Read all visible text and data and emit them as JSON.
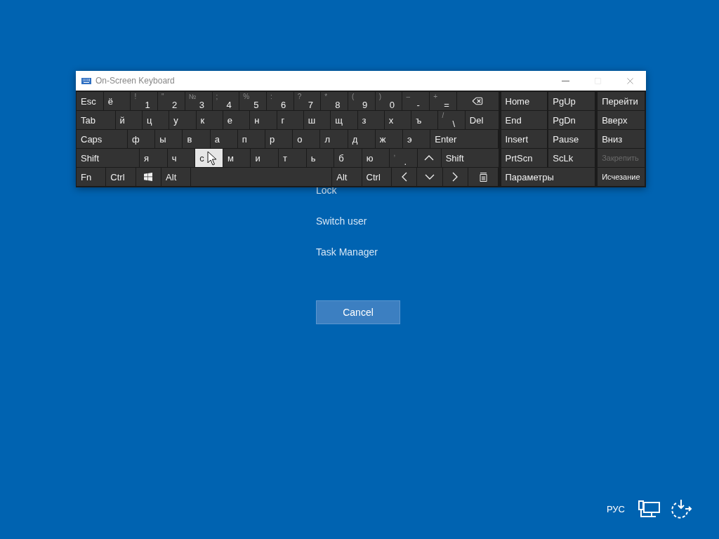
{
  "keyboard": {
    "title": "On-Screen Keyboard",
    "rows": [
      {
        "keys": [
          {
            "label": "Esc",
            "selected": false
          },
          {
            "label": "ё",
            "selected": false
          },
          {
            "label": "1",
            "shift": "!",
            "selected": false
          },
          {
            "label": "2",
            "shift": "\"",
            "selected": false
          },
          {
            "label": "3",
            "shift": "№",
            "selected": false
          },
          {
            "label": "4",
            "shift": ";",
            "selected": false
          },
          {
            "label": "5",
            "shift": "%",
            "selected": false
          },
          {
            "label": "6",
            "shift": ":",
            "selected": false
          },
          {
            "label": "7",
            "shift": "?",
            "selected": false
          },
          {
            "label": "8",
            "shift": "*",
            "selected": false
          },
          {
            "label": "9",
            "shift": "(",
            "selected": false
          },
          {
            "label": "0",
            "shift": ")",
            "selected": false
          },
          {
            "label": "-",
            "shift": "–",
            "selected": false
          },
          {
            "label": "=",
            "shift": "+",
            "selected": false
          },
          {
            "kind": "backspace",
            "selected": false
          }
        ]
      },
      {
        "keys": [
          {
            "label": "Tab",
            "selected": false
          },
          {
            "label": "й",
            "selected": false
          },
          {
            "label": "ц",
            "selected": false
          },
          {
            "label": "у",
            "selected": false
          },
          {
            "label": "к",
            "selected": false
          },
          {
            "label": "е",
            "selected": false
          },
          {
            "label": "н",
            "selected": false
          },
          {
            "label": "г",
            "selected": false
          },
          {
            "label": "ш",
            "selected": false
          },
          {
            "label": "щ",
            "selected": false
          },
          {
            "label": "з",
            "selected": false
          },
          {
            "label": "х",
            "selected": false
          },
          {
            "label": "ъ",
            "selected": false
          },
          {
            "label": "\\",
            "shift": "/",
            "selected": false
          },
          {
            "label": "Del",
            "selected": false
          }
        ]
      },
      {
        "keys": [
          {
            "label": "Caps",
            "selected": false
          },
          {
            "label": "ф",
            "selected": false
          },
          {
            "label": "ы",
            "selected": false
          },
          {
            "label": "в",
            "selected": false
          },
          {
            "label": "а",
            "selected": false
          },
          {
            "label": "п",
            "selected": false
          },
          {
            "label": "р",
            "selected": false
          },
          {
            "label": "о",
            "selected": false
          },
          {
            "label": "л",
            "selected": false
          },
          {
            "label": "д",
            "selected": false
          },
          {
            "label": "ж",
            "selected": false
          },
          {
            "label": "э",
            "selected": false
          },
          {
            "label": "Enter",
            "selected": false
          }
        ]
      },
      {
        "keys": [
          {
            "label": "Shift",
            "selected": false
          },
          {
            "label": "я",
            "selected": false
          },
          {
            "label": "ч",
            "selected": false
          },
          {
            "label": "с",
            "selected": true
          },
          {
            "label": "м",
            "selected": false
          },
          {
            "label": "и",
            "selected": false
          },
          {
            "label": "т",
            "selected": false
          },
          {
            "label": "ь",
            "selected": false
          },
          {
            "label": "б",
            "selected": false
          },
          {
            "label": "ю",
            "selected": false
          },
          {
            "label": ".",
            "shift": ",",
            "selected": false
          },
          {
            "kind": "up",
            "selected": false
          },
          {
            "label": "Shift",
            "selected": false
          }
        ]
      },
      {
        "keys": [
          {
            "label": "Fn",
            "selected": false
          },
          {
            "label": "Ctrl",
            "selected": false
          },
          {
            "kind": "windows",
            "selected": false
          },
          {
            "label": "Alt",
            "selected": false
          },
          {
            "kind": "space",
            "selected": false
          },
          {
            "label": "Alt",
            "selected": false
          },
          {
            "label": "Ctrl",
            "selected": false
          },
          {
            "kind": "left",
            "selected": false
          },
          {
            "kind": "down",
            "selected": false
          },
          {
            "kind": "right",
            "selected": false
          },
          {
            "kind": "menu",
            "selected": false
          }
        ]
      }
    ],
    "nav": [
      [
        "Home",
        "PgUp"
      ],
      [
        "End",
        "PgDn"
      ],
      [
        "Insert",
        "Pause"
      ],
      [
        "PrtScn",
        "ScLk"
      ],
      [
        "Параметры"
      ]
    ],
    "side": [
      {
        "label": "Перейти",
        "disabled": false
      },
      {
        "label": "Вверх",
        "disabled": false
      },
      {
        "label": "Вниз",
        "disabled": false
      },
      {
        "label": "Закрепить",
        "disabled": true
      },
      {
        "label": "Исчезание",
        "disabled": false
      }
    ]
  },
  "options": [
    "Lock",
    "Switch user",
    "Task Manager"
  ],
  "cancel": "Cancel",
  "tray": {
    "language": "РУС"
  }
}
